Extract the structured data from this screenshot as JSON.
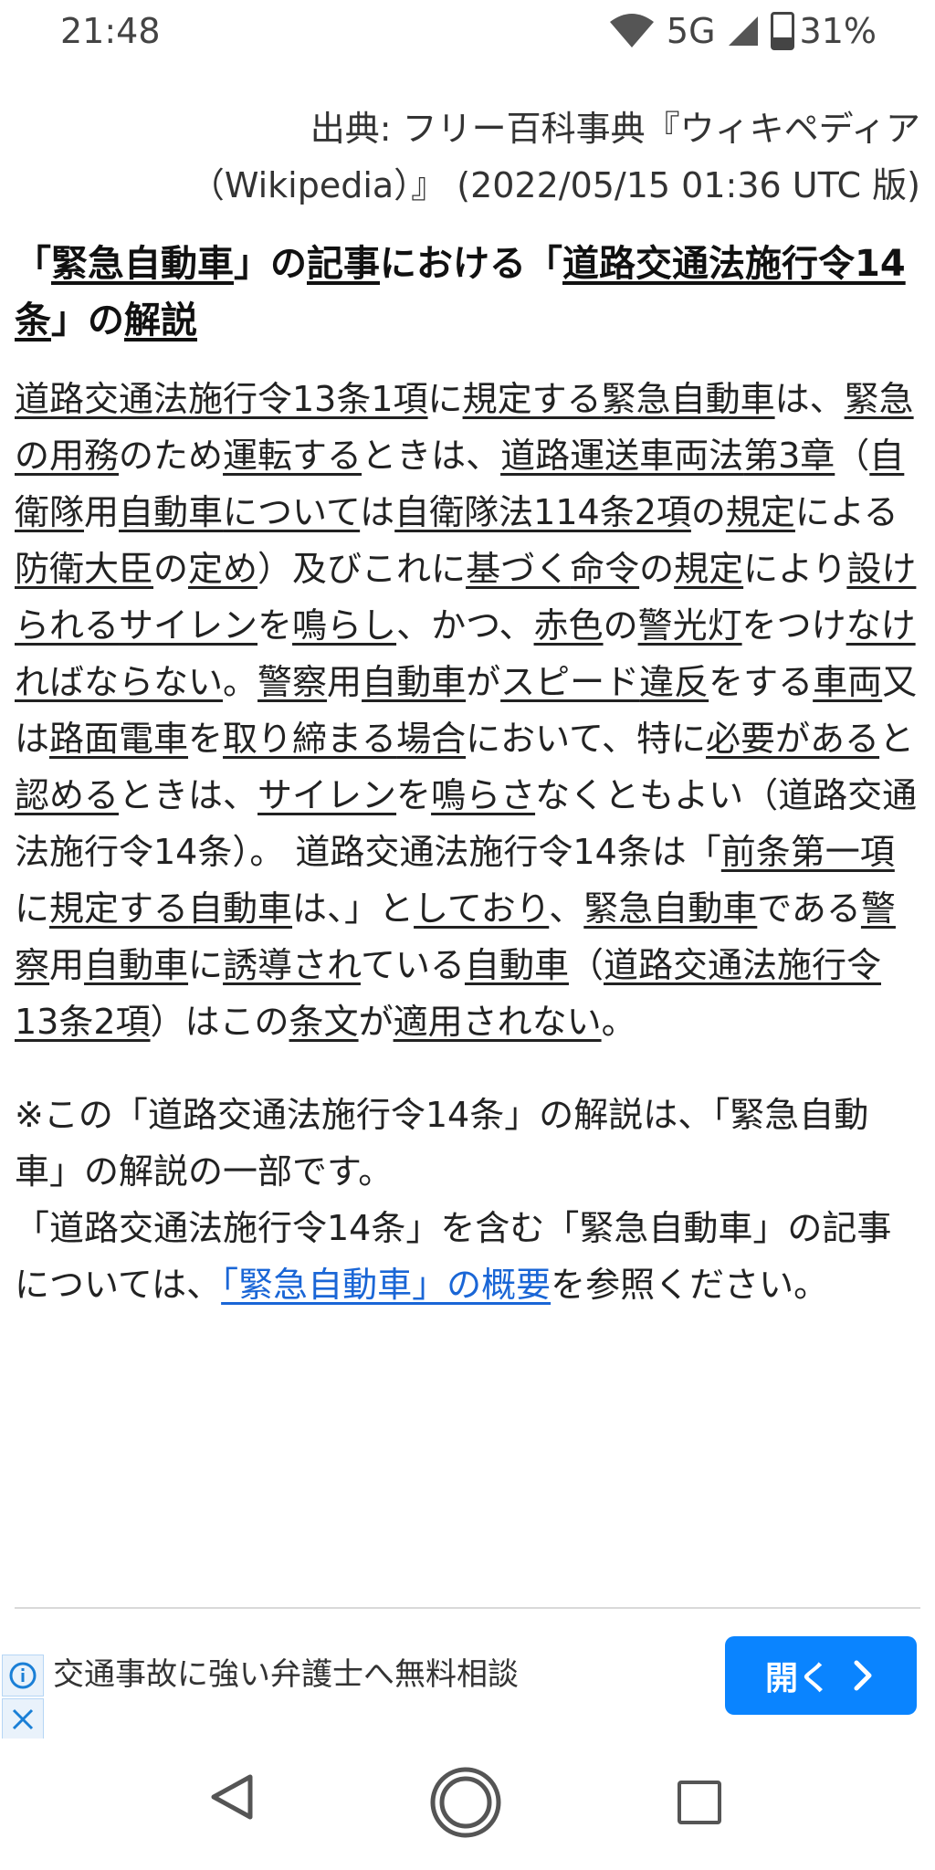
{
  "status_bar": {
    "time": "21:48",
    "network": "5G",
    "battery_text": "31%",
    "battery_level": 0.31,
    "icons": {
      "wifi": "wifi-icon",
      "signal": "signal-icon",
      "battery": "battery-icon"
    }
  },
  "article": {
    "source_line1": "出典: フリー百科事典『ウィキペディア",
    "source_line2": "（Wikipedia）』 (2022/05/15 01:36 UTC 版)",
    "heading_parts": [
      "「",
      "緊急自動車",
      "」の",
      "記事",
      "における「",
      "道路交通法施行令14条",
      "」の",
      "解説"
    ],
    "body_segments": [
      {
        "text": "道路交通法施行令13条1項",
        "u": true
      },
      {
        "text": "に",
        "u": false
      },
      {
        "text": "規定する",
        "u": true
      },
      {
        "text": "緊急自動車",
        "u": true
      },
      {
        "text": "は、",
        "u": false
      },
      {
        "text": "緊急の",
        "u": true
      },
      {
        "text": "用務",
        "u": true
      },
      {
        "text": "のため",
        "u": false
      },
      {
        "text": "運転する",
        "u": true
      },
      {
        "text": "ときは、",
        "u": false
      },
      {
        "text": "道路運送車両法",
        "u": true
      },
      {
        "text": "第3章",
        "u": true
      },
      {
        "text": "（",
        "u": false
      },
      {
        "text": "自衛隊",
        "u": true
      },
      {
        "text": "用",
        "u": false
      },
      {
        "text": "自動車",
        "u": true
      },
      {
        "text": "について",
        "u": true
      },
      {
        "text": "は",
        "u": false
      },
      {
        "text": "自衛隊法114条2項",
        "u": true
      },
      {
        "text": "の",
        "u": false
      },
      {
        "text": "規定",
        "u": true
      },
      {
        "text": "による",
        "u": false
      },
      {
        "text": "防衛大臣",
        "u": true
      },
      {
        "text": "の",
        "u": false
      },
      {
        "text": "定め",
        "u": true
      },
      {
        "text": "）及びこれに",
        "u": false
      },
      {
        "text": "基づく",
        "u": true
      },
      {
        "text": "命令",
        "u": true
      },
      {
        "text": "の",
        "u": false
      },
      {
        "text": "規定",
        "u": true
      },
      {
        "text": "により",
        "u": false
      },
      {
        "text": "設けられる",
        "u": true
      },
      {
        "text": "サイレン",
        "u": true
      },
      {
        "text": "を",
        "u": false
      },
      {
        "text": "鳴らし",
        "u": true
      },
      {
        "text": "、かつ、",
        "u": false
      },
      {
        "text": "赤色",
        "u": true
      },
      {
        "text": "の",
        "u": false
      },
      {
        "text": "警光灯",
        "u": true
      },
      {
        "text": "をつけ",
        "u": false
      },
      {
        "text": "なければならない",
        "u": true
      },
      {
        "text": "。",
        "u": false
      },
      {
        "text": "警察",
        "u": true
      },
      {
        "text": "用",
        "u": false
      },
      {
        "text": "自動車",
        "u": true
      },
      {
        "text": "が",
        "u": false
      },
      {
        "text": "スピード",
        "u": true
      },
      {
        "text": "違反",
        "u": true
      },
      {
        "text": "をする",
        "u": false
      },
      {
        "text": "車両",
        "u": true
      },
      {
        "text": "又は",
        "u": false
      },
      {
        "text": "路面電車",
        "u": true
      },
      {
        "text": "を",
        "u": false
      },
      {
        "text": "取り締まる",
        "u": true
      },
      {
        "text": "場合",
        "u": true
      },
      {
        "text": "において、特に",
        "u": false
      },
      {
        "text": "必要がある",
        "u": true
      },
      {
        "text": "と",
        "u": false
      },
      {
        "text": "認める",
        "u": true
      },
      {
        "text": "ときは、",
        "u": false
      },
      {
        "text": "サイレン",
        "u": true
      },
      {
        "text": "を",
        "u": false
      },
      {
        "text": "鳴らさ",
        "u": true
      },
      {
        "text": "なくともよい（道路交通法施行令14条）。 道路交通法施行令14条は「",
        "u": false
      },
      {
        "text": "前条第一項",
        "u": true
      },
      {
        "text": "に",
        "u": false
      },
      {
        "text": "規定する",
        "u": true
      },
      {
        "text": "自動車",
        "u": true
      },
      {
        "text": "は、」と",
        "u": false
      },
      {
        "text": "しており",
        "u": true
      },
      {
        "text": "、",
        "u": false
      },
      {
        "text": "緊急自動車",
        "u": true
      },
      {
        "text": "である",
        "u": false
      },
      {
        "text": "警察",
        "u": true
      },
      {
        "text": "用",
        "u": false
      },
      {
        "text": "自動車",
        "u": true
      },
      {
        "text": "に",
        "u": false
      },
      {
        "text": "誘導され",
        "u": true
      },
      {
        "text": "ている",
        "u": false
      },
      {
        "text": "自動車",
        "u": true
      },
      {
        "text": "（",
        "u": false
      },
      {
        "text": "道路交通法施行令13条2項",
        "u": true
      },
      {
        "text": "）はこの",
        "u": false
      },
      {
        "text": "条文",
        "u": true
      },
      {
        "text": "が",
        "u": false
      },
      {
        "text": "適用されない",
        "u": true
      },
      {
        "text": "。",
        "u": false
      }
    ],
    "note_line1": "※この「道路交通法施行令14条」の解説は、「緊急自動車」の解説の一部です。",
    "note_line2_prefix": "「道路交通法施行令14条」を含む「緊急自動車」の記事については、",
    "note_link": "「緊急自動車」の概要",
    "note_line2_suffix": "を参照ください。"
  },
  "ad": {
    "text": "交通事故に強い弁護士へ無料相談",
    "button_label": "開く",
    "colors": {
      "button": "#0a84ff"
    }
  },
  "nav": {
    "back": "back-icon",
    "home": "home-icon",
    "recent": "recent-apps-icon"
  }
}
